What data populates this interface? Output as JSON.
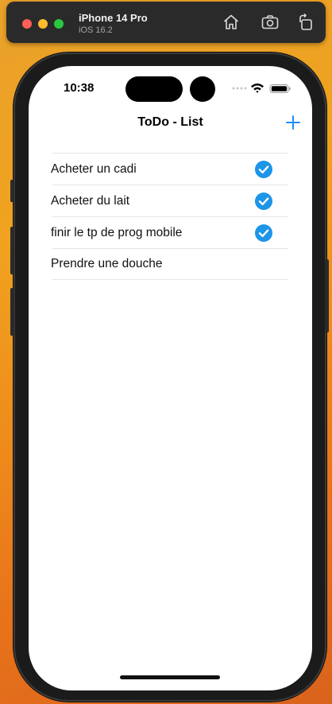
{
  "simulator": {
    "device": "iPhone 14 Pro",
    "os": "iOS 16.2",
    "buttons": [
      "home-icon",
      "screenshot-icon",
      "rotate-icon"
    ]
  },
  "status_bar": {
    "time": "10:38",
    "icons": [
      "signal-dots-icon",
      "wifi-icon",
      "battery-icon"
    ]
  },
  "nav": {
    "title": "ToDo - List",
    "add_icon": "plus-icon"
  },
  "todos": [
    {
      "label": "Acheter un cadi",
      "done": true
    },
    {
      "label": "Acheter du lait",
      "done": true
    },
    {
      "label": "finir le tp de prog mobile",
      "done": true
    },
    {
      "label": "Prendre une douche",
      "done": false
    }
  ],
  "colors": {
    "accent": "#1f8cf0",
    "check": "#1d95e8",
    "sim_bar": "#2b2a2a"
  }
}
